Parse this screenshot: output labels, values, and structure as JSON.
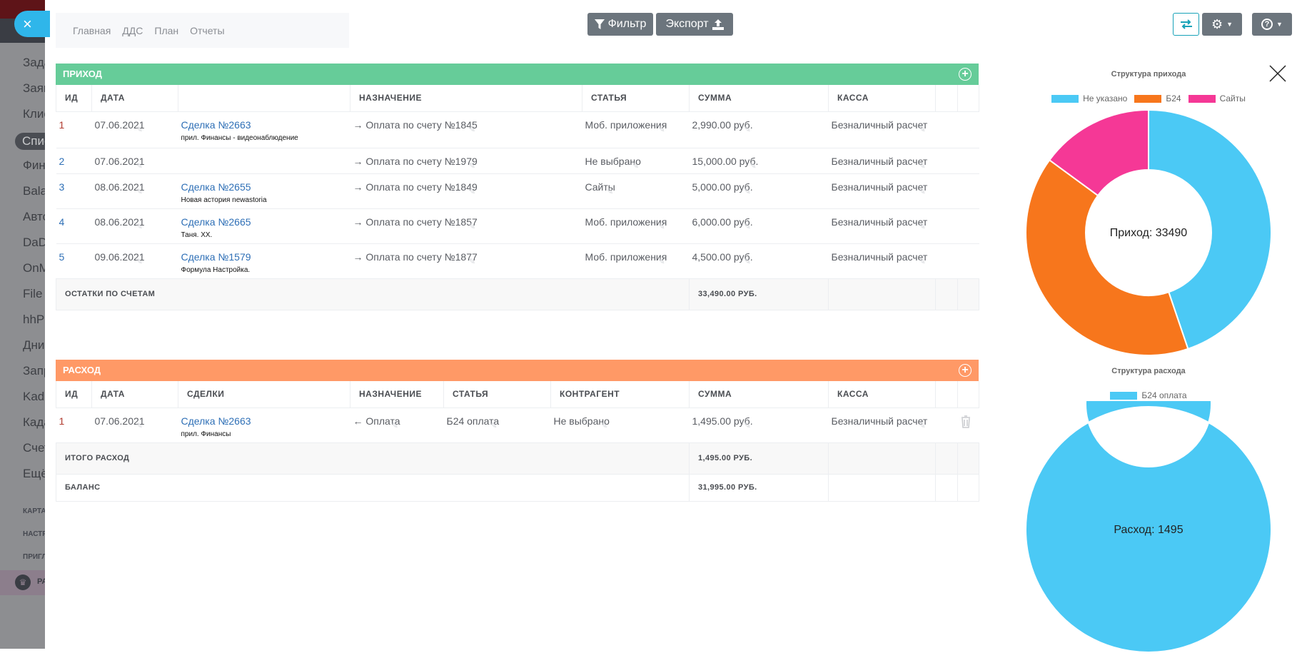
{
  "sidebar": {
    "items": [
      "Зада",
      "Заяв",
      "Клие",
      "Спис",
      "Фин",
      "Bala",
      "Авто",
      "DaD",
      "OnM",
      "File I",
      "hhPa",
      "Дни",
      "Запр",
      "Kada",
      "Када",
      "Счет",
      "Ещё"
    ],
    "active_index": 3,
    "sections": [
      "КАРТА",
      "НАСТР",
      "ПРИГЛ"
    ],
    "crown_label": "РА"
  },
  "close_icon": "×",
  "nav": {
    "items": [
      "Главная",
      "ДДС",
      "План",
      "Отчеты"
    ]
  },
  "toolbar": {
    "filter": "Фильтр",
    "export": "Экспорт"
  },
  "income": {
    "title": "ПРИХОД",
    "headers": [
      "ИД",
      "ДАТА",
      "",
      "НАЗНАЧЕНИЕ",
      "СТАТЬЯ",
      "СУММА",
      "КАССА",
      "",
      ""
    ],
    "rows": [
      {
        "id": "1",
        "date": "07.06.2021",
        "deal": "Сделка №2663",
        "deal_sub": "прил. Финансы - видеонаблюдение",
        "purpose": "→ Оплата по счету №1845",
        "article": "Моб. приложения",
        "sum": "2,990.00 руб.",
        "cash": "Безналичный расчет"
      },
      {
        "id": "2",
        "date": "07.06.2021",
        "deal": "",
        "deal_sub": "",
        "purpose": "→ Оплата по счету №1979",
        "article": "Не выбрано",
        "sum": "15,000.00 руб.",
        "cash": "Безналичный расчет"
      },
      {
        "id": "3",
        "date": "08.06.2021",
        "deal": "Сделка №2655",
        "deal_sub": "Новая астория newastoria",
        "purpose": "→ Оплата по счету №1849",
        "article": "Сайты",
        "sum": "5,000.00 руб.",
        "cash": "Безналичный расчет"
      },
      {
        "id": "4",
        "date": "08.06.2021",
        "deal": "Сделка №2665",
        "deal_sub": "Таня. XX.",
        "purpose": "→ Оплата по счету №1857",
        "article": "Моб. приложения",
        "sum": "6,000.00 руб.",
        "cash": "Безналичный расчет"
      },
      {
        "id": "5",
        "date": "09.06.2021",
        "deal": "Сделка №1579",
        "deal_sub": "Формула Настройка.",
        "purpose": "→ Оплата по счету №1877",
        "article": "Моб. приложения",
        "sum": "4,500.00 руб.",
        "cash": "Безналичный расчет"
      }
    ],
    "total_label": "ОСТАТКИ ПО СЧЕТАМ",
    "total_value": "33,490.00 РУБ."
  },
  "expense": {
    "title": "РАСХОД",
    "headers": [
      "ИД",
      "ДАТА",
      "СДЕЛКИ",
      "НАЗНАЧЕНИЕ",
      "СТАТЬЯ",
      "КОНТРАГЕНТ",
      "СУММА",
      "КАССА",
      "",
      ""
    ],
    "rows": [
      {
        "id": "1",
        "date": "07.06.2021",
        "deal": "Сделка №2663",
        "deal_sub": "прил. Финансы",
        "purpose": "← Оплата",
        "article": "Б24 оплата",
        "counterparty": "Не выбрано",
        "sum": "1,495.00 руб.",
        "cash": "Безналичный расчет"
      }
    ],
    "total_label": "ИТОГО РАСХОД",
    "total_value": "1,495.00 РУБ.",
    "balance_label": "БАЛАНС",
    "balance_value": "31,995.00 РУБ."
  },
  "chart_data": [
    {
      "type": "pie",
      "title": "Структура прихода",
      "center_label": "Приход: 33490",
      "categories": [
        "Не указано",
        "Б24",
        "Сайты"
      ],
      "values": [
        15000,
        13490,
        5000
      ],
      "colors": [
        "#4bc9f5",
        "#f7761c",
        "#f53896"
      ],
      "legend": "top"
    },
    {
      "type": "pie",
      "title": "Структура расхода",
      "center_label": "Расход: 1495",
      "categories": [
        "Б24 оплата"
      ],
      "values": [
        1495
      ],
      "colors": [
        "#4bc9f5"
      ],
      "legend": "top"
    }
  ]
}
